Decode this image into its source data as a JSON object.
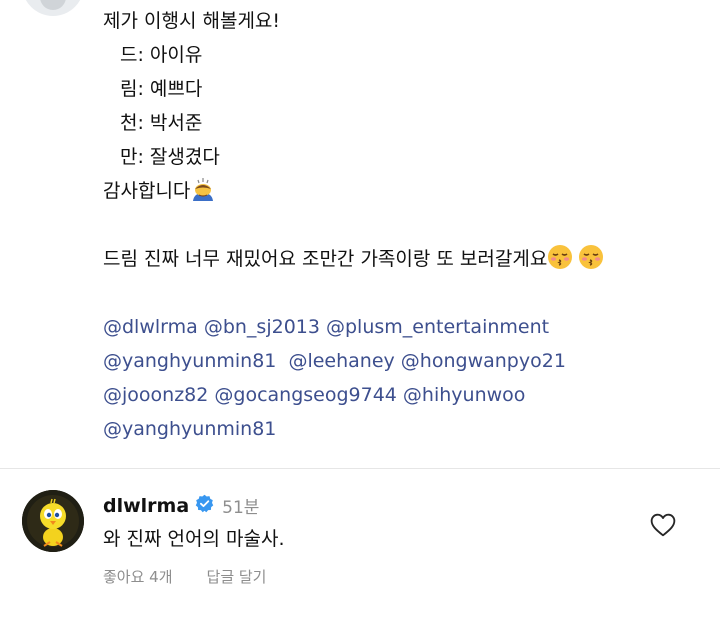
{
  "post": {
    "caption_lines": [
      "제가 이행시 해볼게요!",
      "드: 아이유",
      "림: 예쁘다",
      "천: 박서준",
      "만: 잘생겼다",
      "감사합니다"
    ],
    "comment_line": "드림 진짜 너무 재밌어요 조만간 가족이랑 또 보러갈게요",
    "mentions": [
      "@dlwlrma @bn_sj2013 @plusm_entertainment",
      "@yanghyunmin81  @leehaney @hongwanpyo21",
      "@jooonz82 @gocangseog9744 @hihyunwoo",
      "@yanghyunmin81"
    ],
    "emojis": {
      "bow": "bowing-person-emoji",
      "kiss": "kissing-face-emoji"
    }
  },
  "reply": {
    "username": "dlwlrma",
    "time": "51분",
    "text": "와 진짜 언어의 마술사.",
    "likes": "좋아요 4개",
    "reply_label": "답글 달기",
    "icons": {
      "verified": "verified-badge-icon",
      "like": "heart-icon"
    }
  },
  "colors": {
    "mention": "#3d4f8e",
    "verified": "#3897f0",
    "muted": "#8e8e8e"
  }
}
